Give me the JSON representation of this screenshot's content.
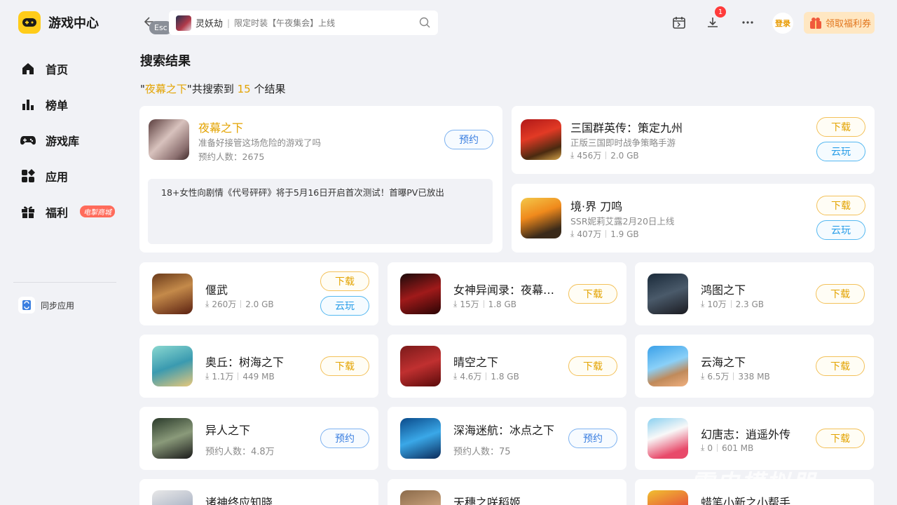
{
  "app": {
    "title": "游戏中心"
  },
  "sidebar": {
    "items": [
      {
        "label": "首页",
        "icon": "home-icon"
      },
      {
        "label": "榜单",
        "icon": "ranking-icon"
      },
      {
        "label": "游戏库",
        "icon": "gamepad-icon"
      },
      {
        "label": "应用",
        "icon": "apps-icon"
      },
      {
        "label": "福利",
        "icon": "gift-icon",
        "badge": "电掣商城"
      }
    ],
    "sync_label": "同步应用"
  },
  "topbar": {
    "esc_label": "Esc",
    "search_title": "灵妖劫",
    "search_sep": "|",
    "search_sub": "限定时装【午夜集会】上线",
    "download_badge": "1",
    "login_label": "登录",
    "coupon_label": "领取福利券"
  },
  "page": {
    "title": "搜索结果",
    "summary_open": "\"",
    "query": "夜幕之下",
    "summary_mid": "\"共搜索到 ",
    "count": "15",
    "summary_end": " 个结果"
  },
  "featured": {
    "title": "夜幕之下",
    "desc": "准备好接管这场危险的游戏了吗",
    "meta": "预约人数：2675",
    "button": "预约",
    "notice": "18+女性向剧情《代号砰砰》将于5月16日开启首次测试！首曝PV已放出"
  },
  "side_games": [
    {
      "title": "三国群英传：策定九州",
      "desc": "正版三国即时战争策略手游",
      "downloads": "456万",
      "size": "2.0 GB",
      "btn1": "下载",
      "btn2": "云玩"
    },
    {
      "title": "境·界 刀鸣",
      "desc": "SSR妮莉艾露2月20日上线",
      "downloads": "407万",
      "size": "1.9 GB",
      "btn1": "下载",
      "btn2": "云玩"
    }
  ],
  "games": [
    {
      "title": "偃武",
      "downloads": "260万",
      "size": "2.0 GB",
      "btn1": "下载",
      "btn2": "云玩"
    },
    {
      "title": "女神异闻录：夜幕…",
      "downloads": "15万",
      "size": "1.8 GB",
      "btn1": "下载"
    },
    {
      "title": "鸿图之下",
      "downloads": "10万",
      "size": "2.3 GB",
      "btn1": "下载"
    },
    {
      "title": "奥丘：树海之下",
      "downloads": "1.1万",
      "size": "449 MB",
      "btn1": "下载"
    },
    {
      "title": "晴空之下",
      "downloads": "4.6万",
      "size": "1.8 GB",
      "btn1": "下载"
    },
    {
      "title": "云海之下",
      "downloads": "6.5万",
      "size": "338 MB",
      "btn1": "下载"
    },
    {
      "title": "异人之下",
      "reserve": "预约人数：4.8万",
      "btn1": "预约"
    },
    {
      "title": "深海迷航：冰点之下",
      "reserve": "预约人数：75",
      "btn1": "预约"
    },
    {
      "title": "幻唐志：逍遥外传",
      "downloads": "0",
      "size": "601 MB",
      "btn1": "下载"
    },
    {
      "title": "诸神终应知晓"
    },
    {
      "title": "天穗之咲稻姬"
    },
    {
      "title": "蜡笔小新之小帮手…"
    }
  ],
  "colors": {
    "accent": "#e3a300",
    "cloud": "#2a9ee8",
    "reserve": "#3b7fe0",
    "badge": "#ff6b5b"
  },
  "watermark": "雷电模拟器"
}
